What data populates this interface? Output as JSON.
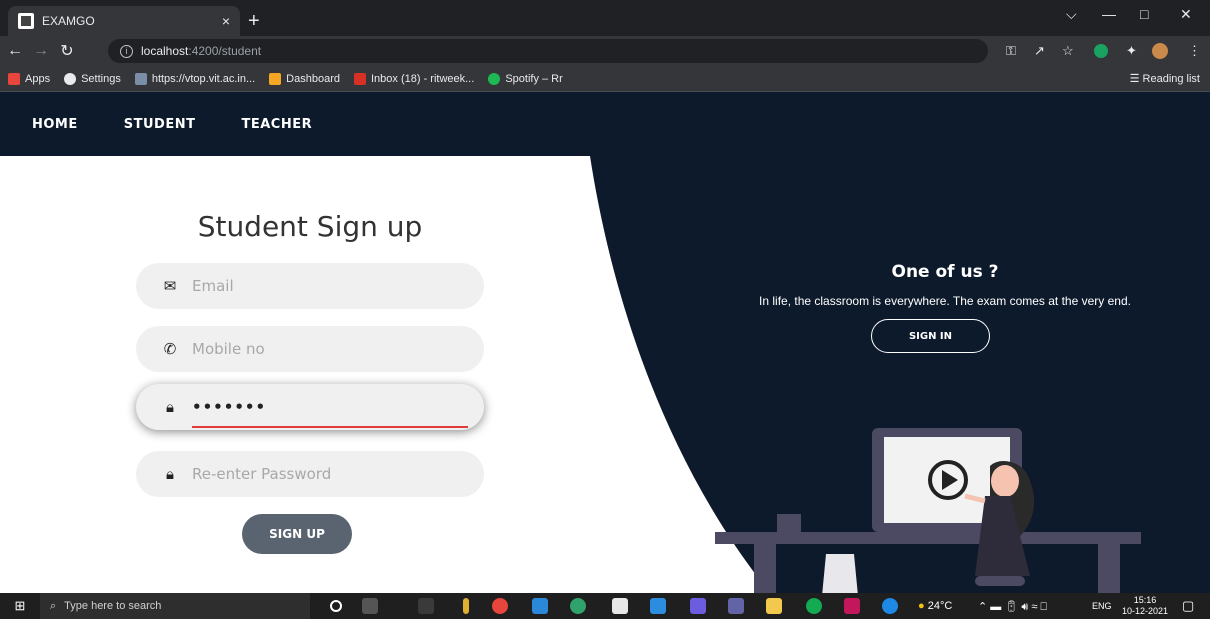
{
  "browser": {
    "tab_title": "EXAMGO",
    "tab_close": "×",
    "new_tab": "+",
    "url_host": "localhost",
    "url_rest": ":4200/student",
    "bookmarks": [
      {
        "label": "Apps",
        "color": "#e8453c"
      },
      {
        "label": "Settings",
        "color": "#e8eaed"
      },
      {
        "label": "https://vtop.vit.ac.in...",
        "color": "#7a8ea8"
      },
      {
        "label": "Dashboard",
        "color": "#f5a623"
      },
      {
        "label": "Inbox (18) - ritweek...",
        "color": "#d93025"
      },
      {
        "label": "Spotify – Rr",
        "color": "#1db954"
      }
    ],
    "reading_list": "Reading list"
  },
  "navbar": {
    "items": [
      "HOME",
      "STUDENT",
      "TEACHER"
    ]
  },
  "signup": {
    "title": "Student Sign up",
    "email_placeholder": "Email",
    "mobile_placeholder": "Mobile no",
    "password_value": "•••••••",
    "reenter_placeholder": "Re-enter Password",
    "button": "SIGN UP"
  },
  "promo": {
    "title": "One of us ?",
    "text": "In life, the classroom is everywhere. The exam comes at the very end.",
    "button": "SIGN IN"
  },
  "taskbar": {
    "search_placeholder": "Type here to search",
    "temperature": "24°C",
    "language": "ENG",
    "time": "15:16",
    "date": "10-12-2021"
  },
  "colors": {
    "navbar_bg": "#0c1a2c",
    "panel_bg": "#0c1a2c",
    "accent_underline": "#e03a3a",
    "signup_button": "#5a6470"
  }
}
